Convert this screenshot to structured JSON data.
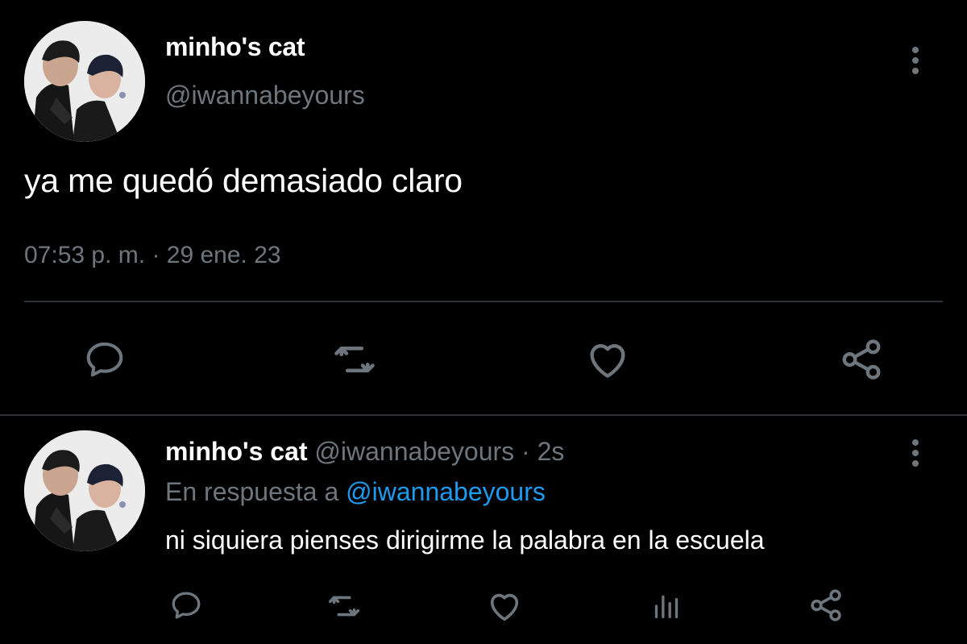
{
  "main_tweet": {
    "display_name": "minho's cat",
    "handle": "@iwannabeyours",
    "text": "ya me quedó demasiado claro",
    "time": "07:53 p. m.",
    "separator": "·",
    "date": "29 ene. 23",
    "actions": [
      "reply-icon",
      "retweet-icon",
      "like-icon",
      "share-icon"
    ]
  },
  "reply": {
    "display_name": "minho's cat",
    "handle": "@iwannabeyours",
    "separator": "·",
    "time": "2s",
    "reply_prefix": "En respuesta a",
    "reply_to": "@iwannabeyours",
    "text": "ni siquiera pienses dirigirme la palabra en la escuela",
    "actions": [
      "reply-icon",
      "retweet-icon",
      "like-icon",
      "analytics-icon",
      "share-icon"
    ]
  },
  "colors": {
    "background": "#000000",
    "primary_text": "#ffffff",
    "secondary_text": "#6e767d",
    "link": "#1d9bf0",
    "divider": "#2f3336"
  }
}
